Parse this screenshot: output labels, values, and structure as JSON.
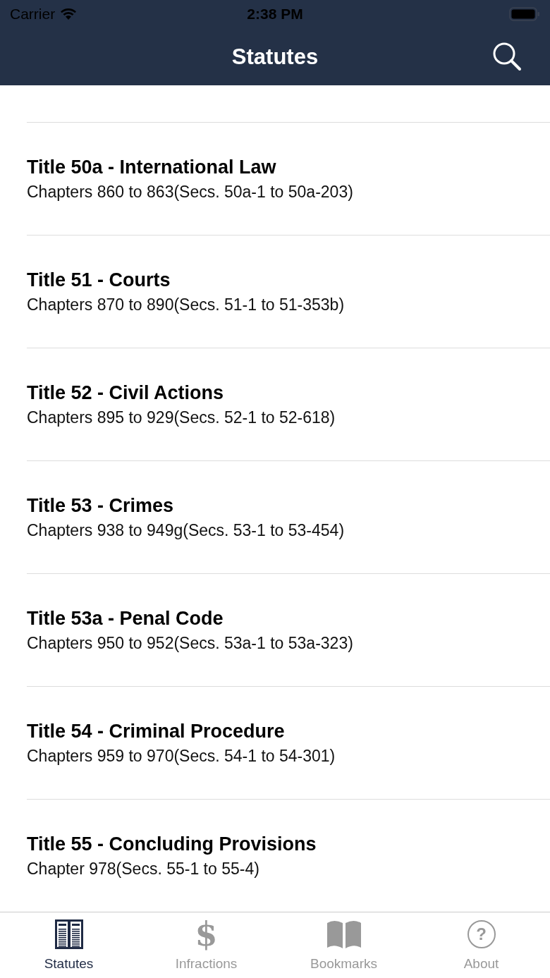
{
  "status_bar": {
    "carrier": "Carrier",
    "time": "2:38 PM"
  },
  "nav": {
    "title": "Statutes"
  },
  "titles": [
    {
      "title": "Title 50a - International Law",
      "subtitle": "Chapters 860 to 863(Secs. 50a-1 to 50a-203)"
    },
    {
      "title": "Title 51 - Courts",
      "subtitle": "Chapters 870 to 890(Secs. 51-1 to 51-353b)"
    },
    {
      "title": "Title 52 - Civil Actions",
      "subtitle": "Chapters 895 to 929(Secs. 52-1 to 52-618)"
    },
    {
      "title": "Title 53 - Crimes",
      "subtitle": "Chapters 938 to 949g(Secs. 53-1 to 53-454)"
    },
    {
      "title": "Title 53a - Penal Code",
      "subtitle": "Chapters 950 to 952(Secs. 53a-1 to 53a-323)"
    },
    {
      "title": "Title 54 - Criminal Procedure",
      "subtitle": "Chapters 959 to 970(Secs. 54-1 to 54-301)"
    },
    {
      "title": "Title 55 - Concluding Provisions",
      "subtitle": "Chapter 978(Secs. 55-1 to 55-4)"
    }
  ],
  "tabs": [
    {
      "label": "Statutes",
      "kind": "books",
      "selected": true
    },
    {
      "label": "Infractions",
      "kind": "dollar",
      "glyph": "$",
      "selected": false
    },
    {
      "label": "Bookmarks",
      "kind": "book",
      "selected": false
    },
    {
      "label": "About",
      "kind": "help",
      "glyph": "?",
      "selected": false
    }
  ]
}
